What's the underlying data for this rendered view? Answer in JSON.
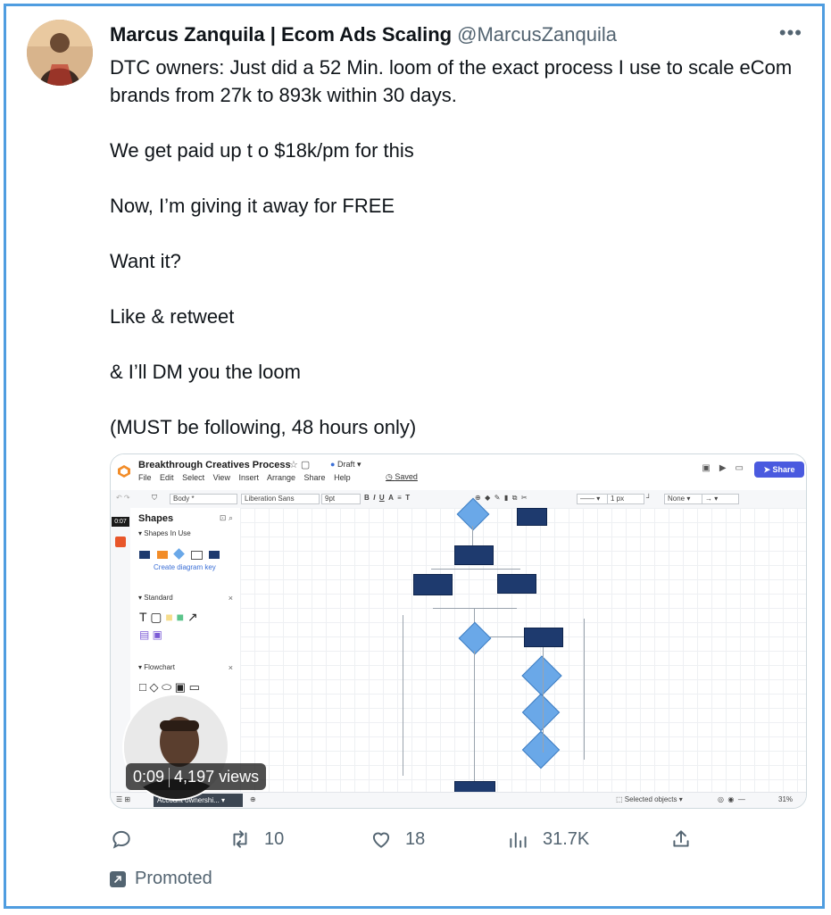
{
  "author": {
    "name": "Marcus Zanquila | Ecom Ads Scaling",
    "handle": "@MarcusZanquila"
  },
  "more_label": "•••",
  "tweet_lines": [
    "DTC owners: Just did a 52 Min. loom of the exact process I use to scale eCom brands from 27k to 893k within 30 days.",
    "We get paid up t o $18k/pm for this",
    "Now, I’m giving it away for FREE",
    "Want it?",
    "Like & retweet",
    "& I’ll DM you the loom",
    "(MUST be following, 48 hours only)"
  ],
  "media": {
    "doc_title": "Breakthrough Creatives Process",
    "draft_label": "Draft",
    "menus": [
      "File",
      "Edit",
      "Select",
      "View",
      "Insert",
      "Arrange",
      "Share",
      "Help"
    ],
    "saved_label": "Saved",
    "share_label": "Share",
    "toolbar": {
      "style_value": "Body *",
      "font_value": "Liberation Sans",
      "size_value": "9pt",
      "line_width": "1 px",
      "arrow_none": "None"
    },
    "rail_time": "0:07",
    "shapes_panel": {
      "title": "Shapes",
      "in_use_label": "Shapes In Use",
      "create_key_label": "Create diagram key",
      "standard_label": "Standard",
      "flowchart_label": "Flowchart"
    },
    "status": {
      "tab_label": "Account ownershi...",
      "selected_label": "Selected objects",
      "zoom": "31%"
    },
    "video_time": "0:09",
    "views": "4,197 views"
  },
  "actions": {
    "replies": "",
    "retweets": "10",
    "likes": "18",
    "views": "31.7K"
  },
  "promoted_label": "Promoted",
  "colors": {
    "frame_border": "#4f9de0",
    "muted_text": "#536471",
    "lucid_share": "#4a5adf",
    "flow_box": "#1e3a6e",
    "flow_diamond": "#6aa8e8"
  }
}
